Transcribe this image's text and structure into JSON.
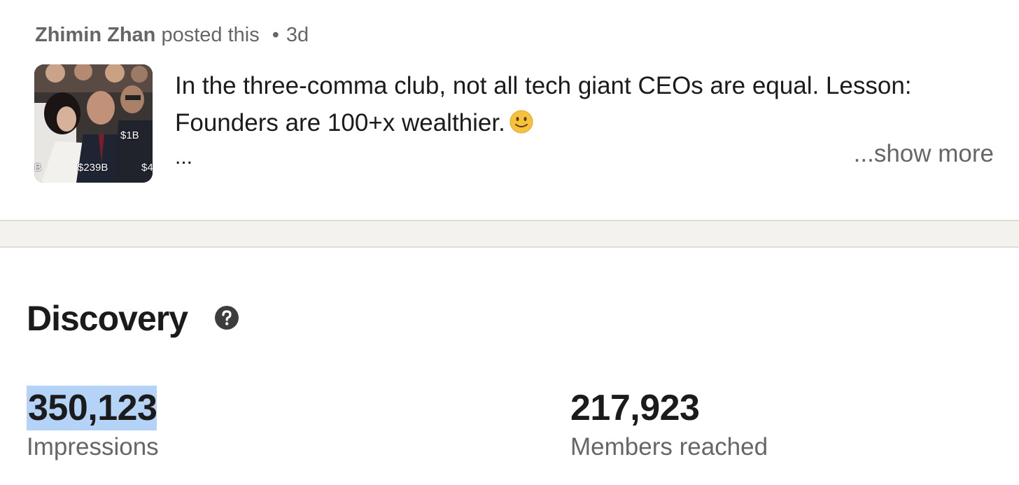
{
  "post": {
    "author": "Zhimin Zhan",
    "action": "posted this",
    "separator": "•",
    "age": "3d",
    "thumbnail": {
      "labels": [
        "$1B",
        "$239B",
        "B",
        "$4"
      ]
    },
    "text_line1": "In the three-comma club, not all tech giant CEOs are equal. Lesson:",
    "text_line2": "Founders are 100+x wealthier.",
    "emoji": "slightly-smiling-face-icon",
    "ellipsis": "...",
    "show_more": "...show more"
  },
  "discovery": {
    "title": "Discovery",
    "help_icon": "question-circle-icon",
    "metrics": [
      {
        "value": "350,123",
        "label": "Impressions",
        "selected": true
      },
      {
        "value": "217,923",
        "label": "Members reached",
        "selected": false
      }
    ]
  },
  "colors": {
    "text_primary": "#1b1b1b",
    "text_secondary": "#666666",
    "divider_band": "#f4f2ee",
    "selection_highlight": "#b4d3f7"
  }
}
